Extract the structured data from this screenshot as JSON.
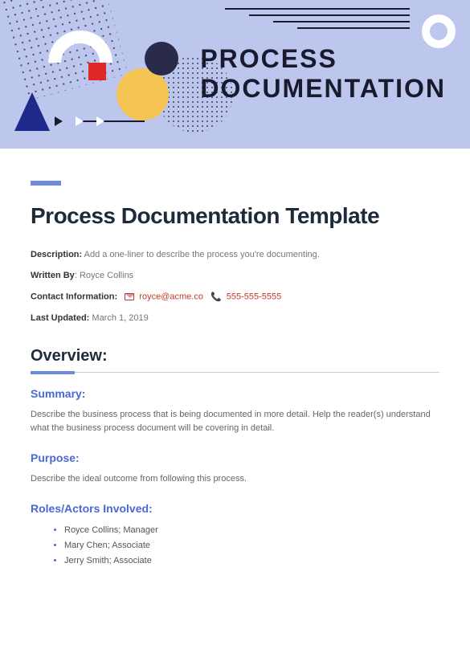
{
  "banner": {
    "title_line1": "PROCESS",
    "title_line2": "DOCUMENTATION"
  },
  "doc": {
    "title": "Process Documentation Template",
    "description_label": "Description:",
    "description_value": "Add a one-liner to describe the process you're documenting.",
    "written_by_label": "Written By",
    "written_by_value": "Royce Collins",
    "contact_label": "Contact Information:",
    "contact_email": "royce@acme.co",
    "contact_phone": "555-555-5555",
    "last_updated_label": "Last Updated:",
    "last_updated_value": "March 1, 2019"
  },
  "overview": {
    "heading": "Overview:",
    "summary_heading": "Summary:",
    "summary_body": "Describe the business process that is being documented in more detail. Help the reader(s) understand what the business process document will be covering in detail.",
    "purpose_heading": "Purpose:",
    "purpose_body": "Describe the ideal outcome from following this process.",
    "roles_heading": "Roles/Actors Involved:",
    "roles": [
      "Royce Collins; Manager",
      "Mary Chen; Associate",
      "Jerry Smith; Associate"
    ]
  }
}
